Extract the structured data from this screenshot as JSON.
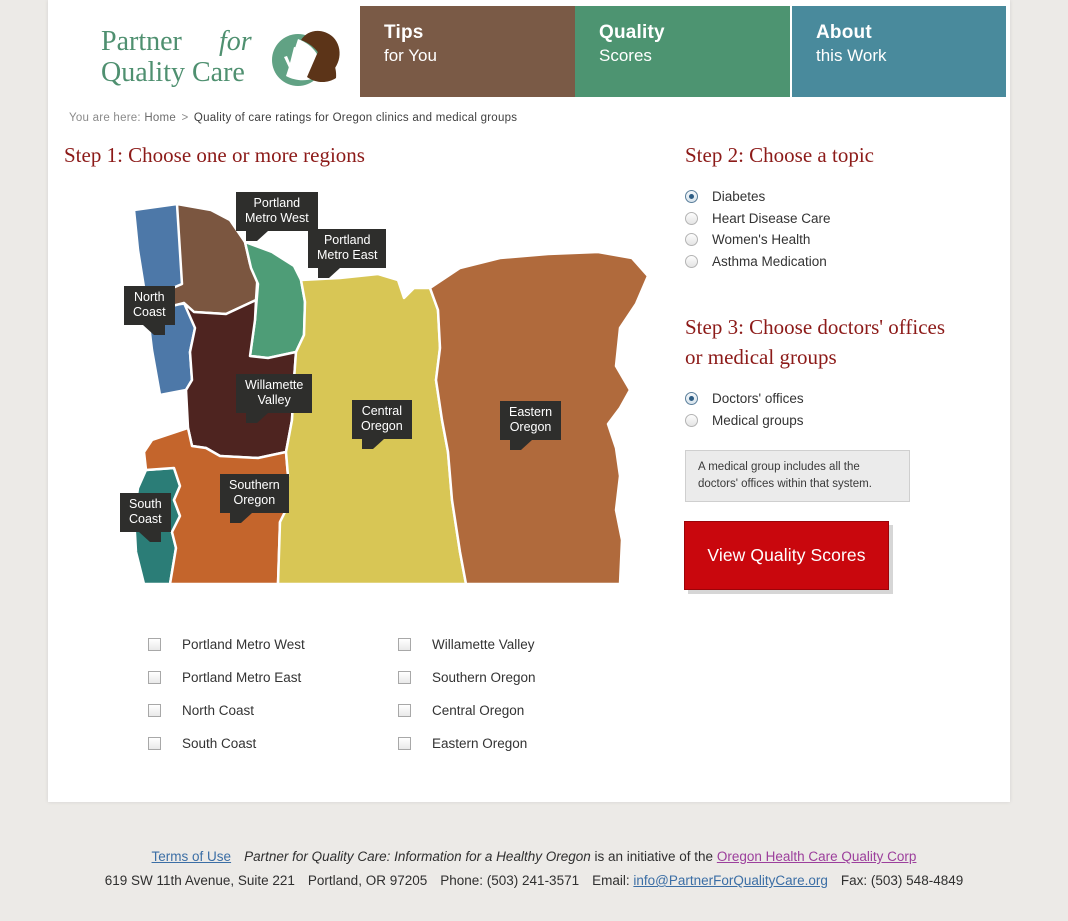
{
  "header": {
    "logo": {
      "line1_a": "Partner",
      "line1_b": "for",
      "line2": "Quality Care",
      "icon": "leaf-check-logo-icon",
      "color_green": "#4f9070",
      "color_brown": "#5c3418"
    },
    "tabs": [
      {
        "title": "Tips",
        "subtitle": "for You",
        "color": "#7a5a46"
      },
      {
        "title": "Quality",
        "subtitle": "Scores",
        "color": "#4d9471"
      },
      {
        "title": "About",
        "subtitle": "this Work",
        "color": "#498a9c"
      }
    ]
  },
  "breadcrumb": {
    "prefix": "You are here:",
    "home": "Home",
    "separator": ">",
    "current": "Quality of care ratings for Oregon clinics and medical groups"
  },
  "step1": {
    "heading": "Step 1: Choose one or more regions",
    "map_alt": "Map of Oregon divided into eight quality-care regions",
    "regions": [
      {
        "id": "portland-metro-west",
        "label": "Portland Metro West",
        "map_label": "Portland\nMetro West",
        "color": "#7b5640",
        "checked": false
      },
      {
        "id": "portland-metro-east",
        "label": "Portland Metro East",
        "map_label": "Portland\nMetro East",
        "color": "#4e9d77",
        "checked": false
      },
      {
        "id": "north-coast",
        "label": "North Coast",
        "map_label": "North\nCoast",
        "color": "#4d78a8",
        "checked": false
      },
      {
        "id": "south-coast",
        "label": "South Coast",
        "map_label": "South\nCoast",
        "color": "#2b7d77",
        "checked": false
      },
      {
        "id": "willamette-valley",
        "label": "Willamette Valley",
        "map_label": "Willamette\nValley",
        "color": "#4e2420",
        "checked": false
      },
      {
        "id": "southern-oregon",
        "label": "Southern Oregon",
        "map_label": "Southern\nOregon",
        "color": "#c4652c",
        "checked": false
      },
      {
        "id": "central-oregon",
        "label": "Central Oregon",
        "map_label": "Central\nOregon",
        "color": "#d7c css",
        "checked": false
      },
      {
        "id": "eastern-oregon",
        "label": "Eastern Oregon",
        "map_label": "Eastern\nOregon",
        "color": "#b06a3c",
        "checked": false
      }
    ],
    "map_labels": {
      "pmw_l1": "Portland",
      "pmw_l2": "Metro West",
      "pme_l1": "Portland",
      "pme_l2": "Metro East",
      "nc_l1": "North",
      "nc_l2": "Coast",
      "wv_l1": "Willamette",
      "wv_l2": "Valley",
      "co_l1": "Central",
      "co_l2": "Oregon",
      "eo_l1": "Eastern",
      "eo_l2": "Oregon",
      "so_l1": "Southern",
      "so_l2": "Oregon",
      "sc_l1": "South",
      "sc_l2": "Coast"
    },
    "checkbox_column_left": [
      "Portland Metro West",
      "Portland Metro East",
      "North Coast",
      "South Coast"
    ],
    "checkbox_column_right": [
      "Willamette Valley",
      "Southern Oregon",
      "Central Oregon",
      "Eastern Oregon"
    ]
  },
  "step2": {
    "heading": "Step 2: Choose a topic",
    "options": [
      {
        "label": "Diabetes",
        "checked": true
      },
      {
        "label": "Heart Disease Care",
        "checked": false
      },
      {
        "label": "Women's Health",
        "checked": false
      },
      {
        "label": "Asthma Medication",
        "checked": false
      }
    ]
  },
  "step3": {
    "heading_line1": "Step 3: Choose doctors' offices",
    "heading_line2": "or medical groups",
    "options": [
      {
        "label": "Doctors' offices",
        "checked": true
      },
      {
        "label": "Medical groups",
        "checked": false
      }
    ],
    "note_line1": "A medical group includes all the",
    "note_line2": "doctors' offices within that system.",
    "cta_label": "View Quality Scores",
    "cta_color": "#c9070d"
  },
  "footer": {
    "terms_link": "Terms of Use",
    "tagline_italic": "Partner for Quality Care: Information for a Healthy Oregon",
    "tagline_rest": "is an initiative of the",
    "org_link": "Oregon Health Care Quality Corp",
    "address": "619 SW 11th Avenue, Suite 221",
    "city_state_zip": "Portland, OR 97205",
    "phone": "Phone: (503) 241-3571",
    "email_label": "Email:",
    "email_link": "info@PartnerForQualityCare.org",
    "fax": "Fax: (503) 548-4849"
  }
}
